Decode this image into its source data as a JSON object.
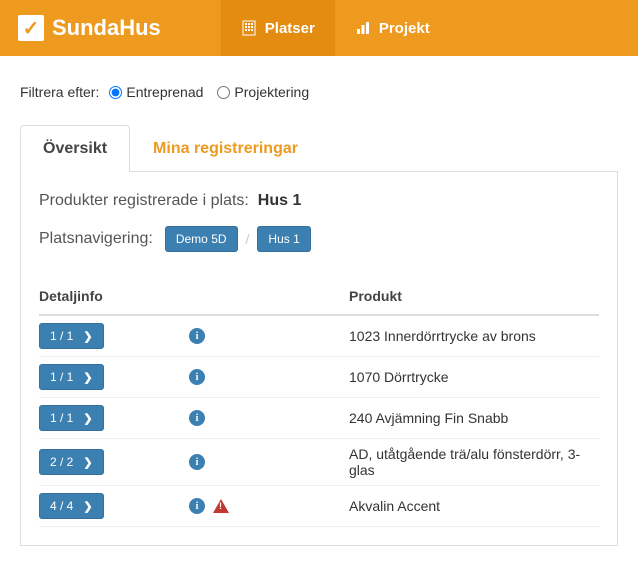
{
  "app": {
    "name": "SundaHus"
  },
  "nav": {
    "platser": "Platser",
    "projekt": "Projekt"
  },
  "filter": {
    "label": "Filtrera efter:",
    "options": {
      "entreprenad": "Entreprenad",
      "projektering": "Projektering"
    },
    "selected": "entreprenad"
  },
  "tabs": {
    "overview": "Översikt",
    "registrations": "Mina registreringar"
  },
  "panel": {
    "title_prefix": "Produkter registrerade i plats:",
    "place_name": "Hus 1",
    "breadcrumb_label": "Platsnavigering:",
    "crumbs": [
      "Demo 5D",
      "Hus 1"
    ]
  },
  "table": {
    "headers": {
      "detail": "Detaljinfo",
      "product": "Produkt"
    },
    "rows": [
      {
        "count": "1 / 1",
        "warning": false,
        "product": "1023 Innerdörrtrycke av brons"
      },
      {
        "count": "1 / 1",
        "warning": false,
        "product": "1070 Dörrtrycke"
      },
      {
        "count": "1 / 1",
        "warning": false,
        "product": "240 Avjämning Fin Snabb"
      },
      {
        "count": "2 / 2",
        "warning": false,
        "product": "AD, utåtgående trä/alu fönsterdörr, 3-glas"
      },
      {
        "count": "4 / 4",
        "warning": true,
        "product": "Akvalin Accent"
      }
    ]
  }
}
